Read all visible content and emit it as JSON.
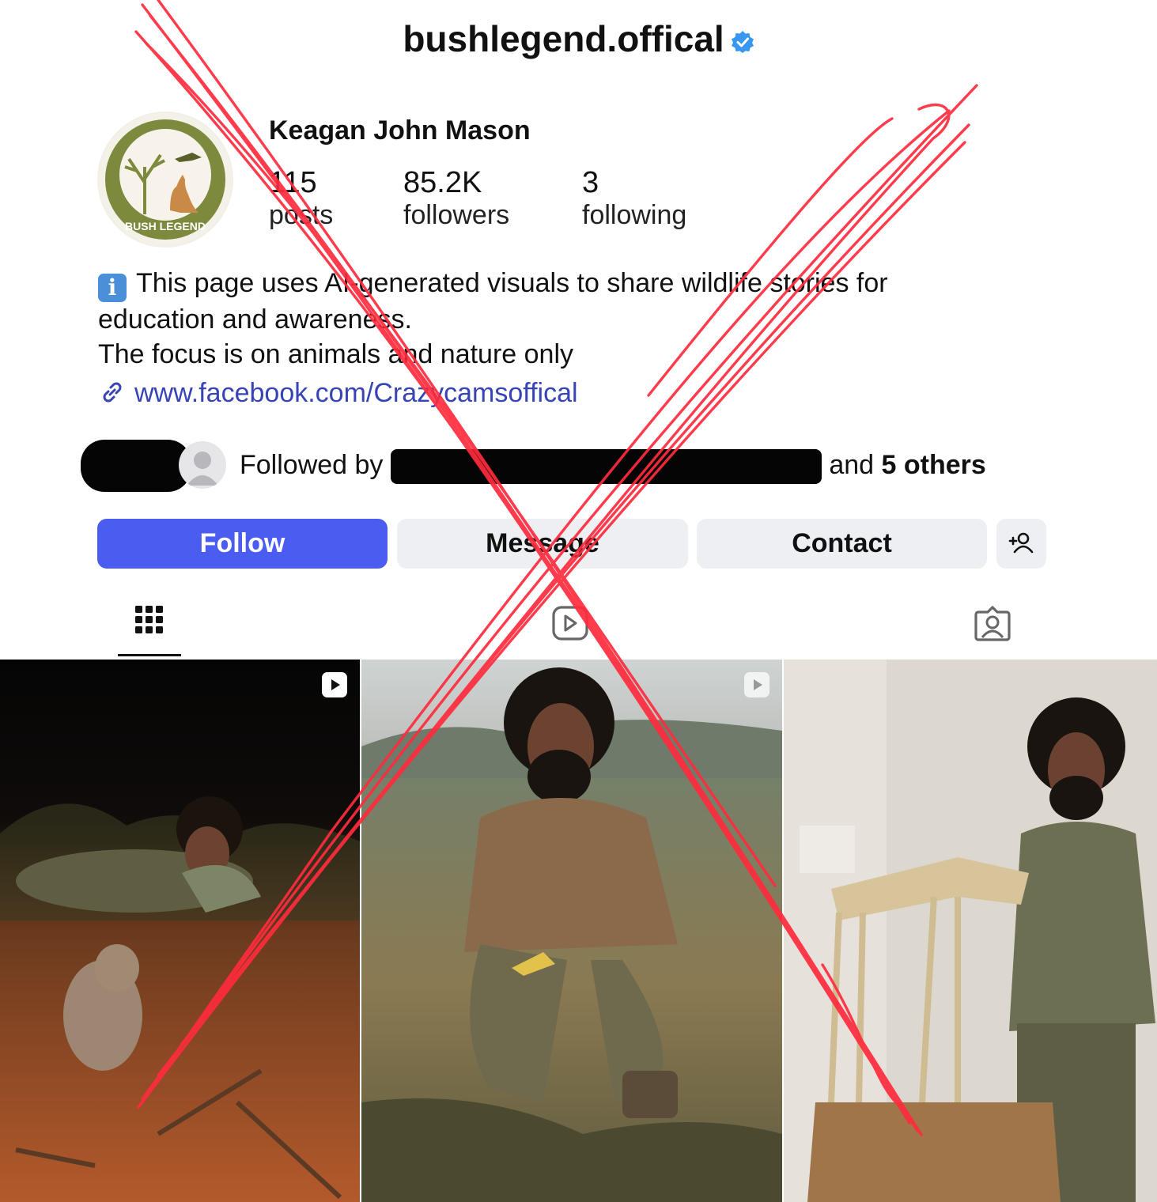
{
  "header": {
    "username": "bushlegend.offical",
    "verified_icon": "verified-badge-icon"
  },
  "profile": {
    "full_name": "Keagan John Mason",
    "avatar_text": "BUSH LEGEND",
    "stats": [
      {
        "value": "115",
        "label": "posts"
      },
      {
        "value": "85.2K",
        "label": "followers"
      },
      {
        "value": "3",
        "label": "following"
      }
    ],
    "bio_line1": "This page uses AI-generated visuals to share wildlife stories for",
    "bio_line2": "education and awareness.",
    "bio_line3": "The focus is on animals and nature only",
    "link": "www.facebook.com/Crazycamsoffical",
    "followed_by_prefix": "Followed by",
    "followed_by_suffix_plain": "and",
    "followed_by_suffix_bold": "5 others"
  },
  "actions": {
    "follow": "Follow",
    "message": "Message",
    "contact": "Contact",
    "add_user_icon": "add-user-icon"
  },
  "tabs": [
    "grid-icon",
    "reels-icon",
    "tagged-icon"
  ],
  "colors": {
    "follow_button": "#4a5df0",
    "secondary_button": "#eeeff2",
    "link": "#3744b6",
    "verified": "#3897f0",
    "cross_mark": "#ff2b3d"
  }
}
